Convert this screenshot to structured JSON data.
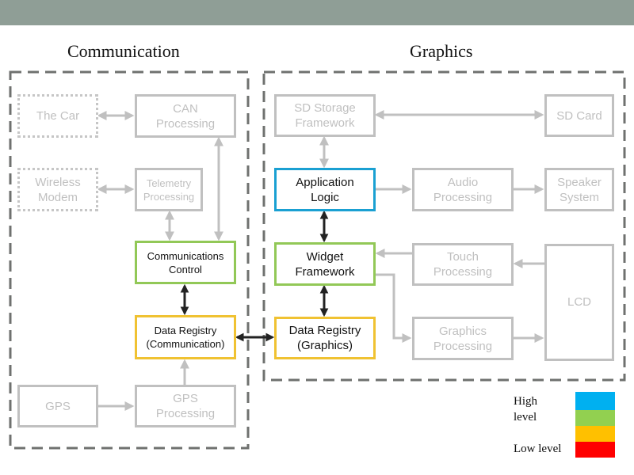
{
  "header": {
    "bar_color": "#8f9e96"
  },
  "sections": {
    "communication": {
      "title": "Communication"
    },
    "graphics": {
      "title": "Graphics"
    }
  },
  "blocks": {
    "the_car": {
      "label": "The Car",
      "level": "external"
    },
    "can_processing": {
      "label": "CAN\nProcessing",
      "level": "inactive"
    },
    "wireless_modem": {
      "label": "Wireless\nModem",
      "level": "external"
    },
    "telemetry_processing": {
      "label": "Telemetry\nProcessing",
      "level": "inactive"
    },
    "communications_control": {
      "label": "Communications\nControl",
      "level": "green"
    },
    "data_registry_comm": {
      "label": "Data Registry\n(Communication)",
      "level": "yellow"
    },
    "gps": {
      "label": "GPS",
      "level": "inactive"
    },
    "gps_processing": {
      "label": "GPS\nProcessing",
      "level": "inactive"
    },
    "sd_storage_framework": {
      "label": "SD Storage\nFramework",
      "level": "inactive"
    },
    "sd_card": {
      "label": "SD Card",
      "level": "inactive"
    },
    "application_logic": {
      "label": "Application\nLogic",
      "level": "blue"
    },
    "audio_processing": {
      "label": "Audio\nProcessing",
      "level": "inactive"
    },
    "speaker_system": {
      "label": "Speaker\nSystem",
      "level": "inactive"
    },
    "widget_framework": {
      "label": "Widget\nFramework",
      "level": "green"
    },
    "touch_processing": {
      "label": "Touch\nProcessing",
      "level": "inactive"
    },
    "lcd": {
      "label": "LCD",
      "level": "inactive"
    },
    "data_registry_graphics": {
      "label": "Data Registry\n(Graphics)",
      "level": "yellow"
    },
    "graphics_processing": {
      "label": "Graphics\nProcessing",
      "level": "inactive"
    }
  },
  "connections": [
    {
      "from": "the_car",
      "to": "can_processing",
      "direction": "both"
    },
    {
      "from": "wireless_modem",
      "to": "telemetry_processing",
      "direction": "both"
    },
    {
      "from": "telemetry_processing",
      "to": "communications_control",
      "direction": "both"
    },
    {
      "from": "can_processing",
      "to": "communications_control",
      "direction": "both"
    },
    {
      "from": "communications_control",
      "to": "data_registry_comm",
      "direction": "both",
      "highlighted": true
    },
    {
      "from": "data_registry_comm",
      "to": "data_registry_graphics",
      "direction": "both",
      "highlighted": true
    },
    {
      "from": "gps",
      "to": "gps_processing",
      "direction": "forward"
    },
    {
      "from": "gps_processing",
      "to": "data_registry_comm",
      "direction": "forward"
    },
    {
      "from": "sd_storage_framework",
      "to": "sd_card",
      "direction": "both"
    },
    {
      "from": "sd_storage_framework",
      "to": "application_logic",
      "direction": "both"
    },
    {
      "from": "application_logic",
      "to": "audio_processing",
      "direction": "forward"
    },
    {
      "from": "audio_processing",
      "to": "speaker_system",
      "direction": "forward"
    },
    {
      "from": "application_logic",
      "to": "widget_framework",
      "direction": "both",
      "highlighted": true
    },
    {
      "from": "widget_framework",
      "to": "data_registry_graphics",
      "direction": "both",
      "highlighted": true
    },
    {
      "from": "touch_processing",
      "to": "widget_framework",
      "direction": "forward"
    },
    {
      "from": "lcd",
      "to": "touch_processing",
      "direction": "forward"
    },
    {
      "from": "widget_framework",
      "to": "graphics_processing",
      "direction": "forward"
    },
    {
      "from": "graphics_processing",
      "to": "lcd",
      "direction": "forward"
    }
  ],
  "legend": {
    "high_label": "High\nlevel",
    "low_label": "Low level",
    "levels": [
      {
        "name": "blue",
        "color": "#00b0f0"
      },
      {
        "name": "green",
        "color": "#92d050"
      },
      {
        "name": "yellow",
        "color": "#ffc000"
      },
      {
        "name": "red",
        "color": "#ff0000"
      }
    ]
  }
}
